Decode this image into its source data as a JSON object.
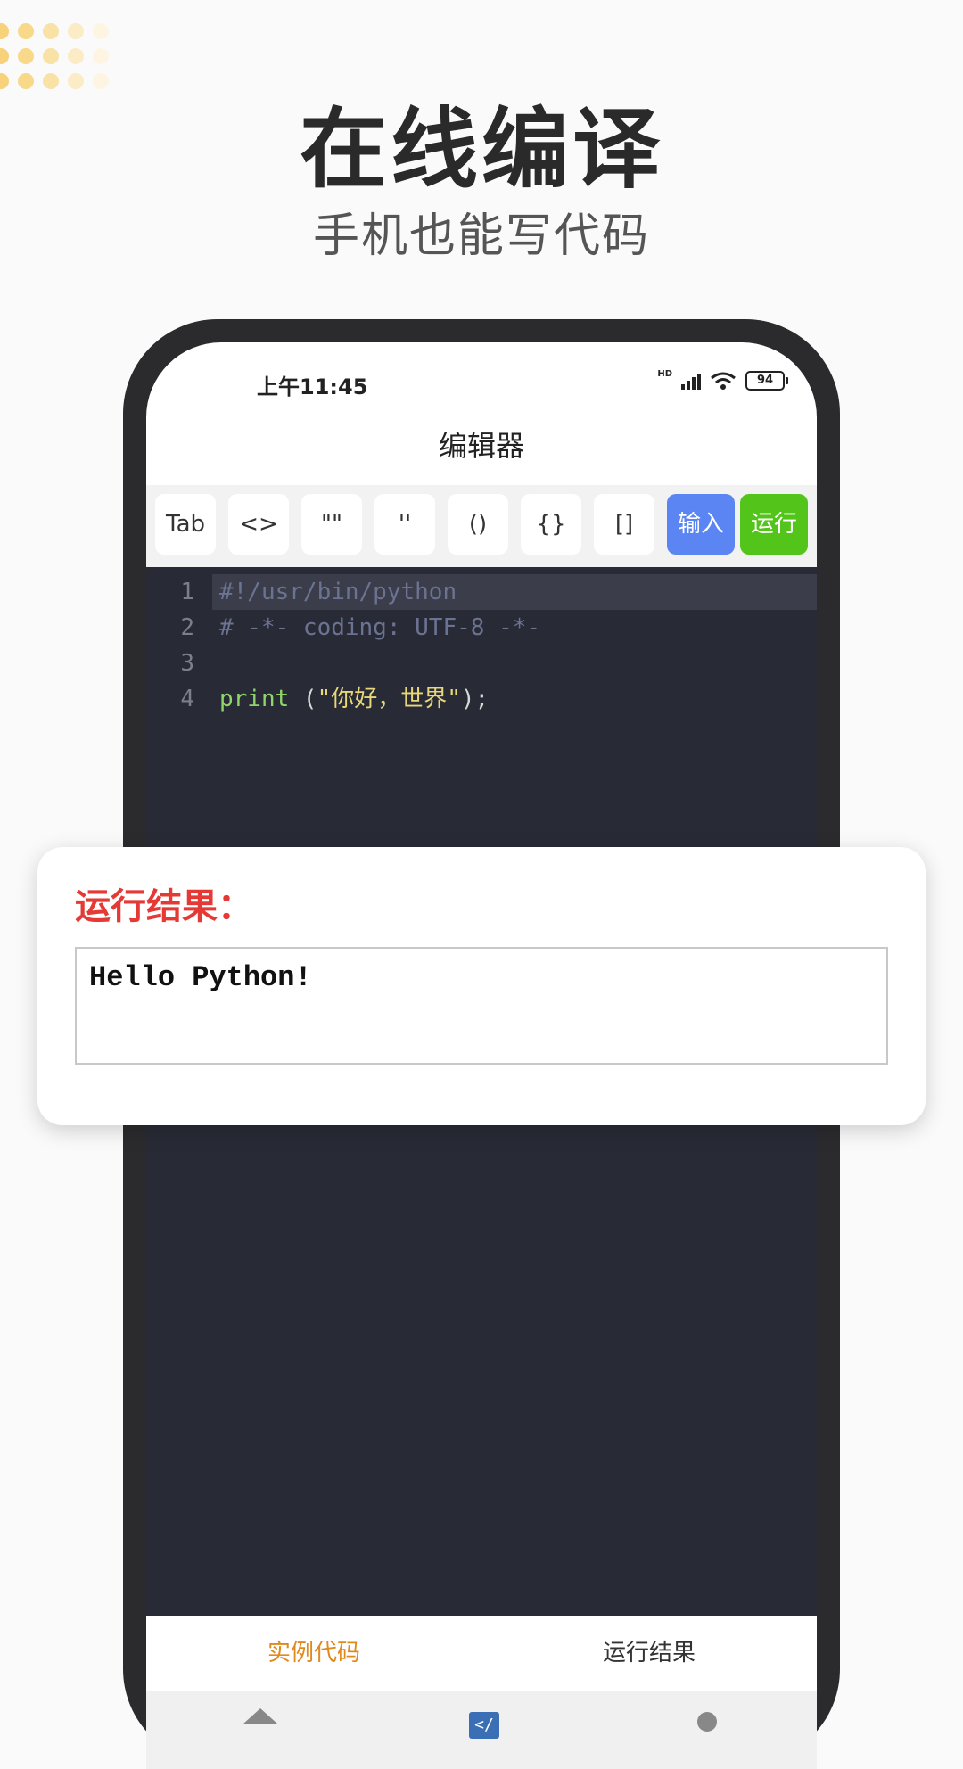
{
  "promo": {
    "headline": "在线编译",
    "subhead": "手机也能写代码",
    "dot_color": "#f7d27a"
  },
  "status_bar": {
    "time": "上午11:45",
    "signal_label": "HD",
    "battery": "94"
  },
  "header": {
    "title": "编辑器"
  },
  "toolbar": {
    "keys": [
      "Tab",
      "<>",
      "\"\"",
      "''",
      "()",
      "{}",
      "[]"
    ],
    "input_label": "输入",
    "run_label": "运行"
  },
  "editor": {
    "lines": [
      {
        "num": "1",
        "text": "#!/usr/bin/python"
      },
      {
        "num": "2",
        "text": "# -*- coding: UTF-8 -*-"
      },
      {
        "num": "3",
        "text": ""
      },
      {
        "num": "4",
        "kw": "print",
        "open": " (",
        "str": "\"你好，世界\"",
        "close": ");"
      }
    ]
  },
  "result_card": {
    "title": "运行结果：",
    "output": "Hello Python!"
  },
  "bottom_tabs": {
    "examples": "实例代码",
    "results": "运行结果"
  },
  "nav": {
    "home_icon": "home-icon",
    "code_icon": "code-icon",
    "code_glyph": "</",
    "user_icon": "user-icon"
  },
  "colors": {
    "accent_blue": "#5b85f2",
    "accent_green": "#52c41a",
    "tab_active": "#e08a1e",
    "result_title": "#e53935"
  }
}
